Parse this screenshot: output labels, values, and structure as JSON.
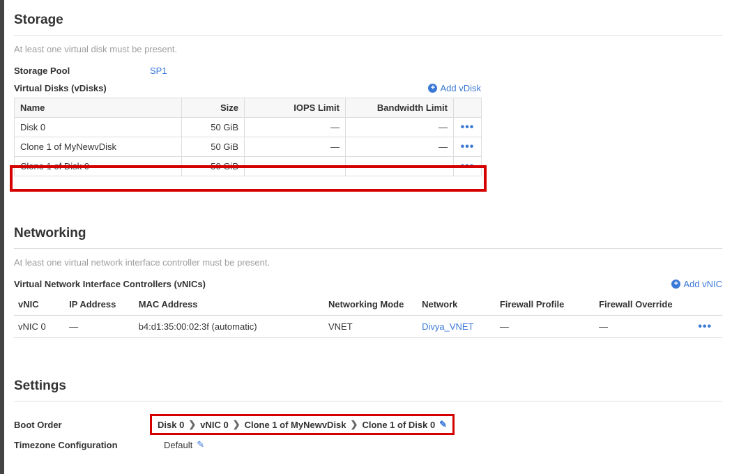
{
  "storage": {
    "heading": "Storage",
    "hint": "At least one virtual disk must be present.",
    "pool_label": "Storage Pool",
    "pool_value": "SP1",
    "vdisks_label": "Virtual Disks (vDisks)",
    "add_label": "Add vDisk",
    "cols": {
      "name": "Name",
      "size": "Size",
      "iops": "IOPS Limit",
      "bw": "Bandwidth Limit"
    },
    "rows": [
      {
        "name": "Disk 0",
        "size": "50 GiB",
        "iops": "—",
        "bw": "—"
      },
      {
        "name": "Clone 1 of MyNewvDisk",
        "size": "50 GiB",
        "iops": "—",
        "bw": "—"
      },
      {
        "name": "Clone 1 of Disk 0",
        "size": "50 GiB",
        "iops": "—",
        "bw": "—"
      }
    ]
  },
  "networking": {
    "heading": "Networking",
    "hint": "At least one virtual network interface controller must be present.",
    "vnics_label": "Virtual Network Interface Controllers (vNICs)",
    "add_label": "Add vNIC",
    "cols": {
      "vnic": "vNIC",
      "ip": "IP Address",
      "mac": "MAC Address",
      "mode": "Networking Mode",
      "net": "Network",
      "fw": "Firewall Profile",
      "fwo": "Firewall Override"
    },
    "rows": [
      {
        "vnic": "vNIC 0",
        "ip": "—",
        "mac": "b4:d1:35:00:02:3f (automatic)",
        "mode": "VNET",
        "net": "Divya_VNET",
        "fw": "—",
        "fwo": "—"
      }
    ]
  },
  "settings": {
    "heading": "Settings",
    "boot_label": "Boot Order",
    "boot_order": [
      "Disk 0",
      "vNIC 0",
      "Clone 1 of MyNewvDisk",
      "Clone 1 of Disk 0"
    ],
    "tz_label": "Timezone Configuration",
    "tz_value": "Default"
  },
  "dots": "•••"
}
